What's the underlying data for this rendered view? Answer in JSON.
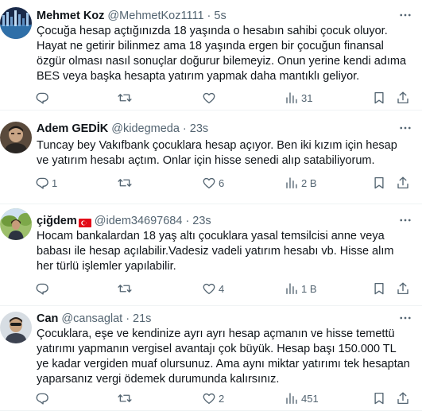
{
  "tweets": [
    {
      "name": "Mehmet Koz",
      "handle": "@MehmetKoz1111",
      "time": "5s",
      "text": "Çocuğa hesap açtığınızda 18 yaşında o hesabın sahibi çocuk oluyor. Hayat ne getirir bilinmez ama 18 yaşında ergen bir çocuğun finansal özgür olması nasıl sonuçlar doğurur bilemeyiz. Onun yerine kendi adıma BES veya başka hesapta yatırım yapmak daha mantıklı geliyor.",
      "replies": "",
      "retweets": "",
      "likes": "",
      "views": "31"
    },
    {
      "name": "Adem GEDİK",
      "handle": "@kidegmeda",
      "time": "23s",
      "text": "Tuncay bey Vakıfbank çocuklara hesap açıyor. Ben iki kızım için hesap ve yatırım hesabı açtım. Onlar için hisse senedi alıp satabiliyorum.",
      "replies": "1",
      "retweets": "",
      "likes": "6",
      "views": "2 B"
    },
    {
      "name": "çiğdem",
      "handle": "@idem34697684",
      "time": "23s",
      "text": "Hocam bankalardan 18 yaş altı çocuklara yasal temsilcisi anne veya babası ile hesap açılabilir.Vadesiz vadeli yatırım hesabı vb. Hisse alım her türlü işlemler yapılabilir.",
      "replies": "",
      "retweets": "",
      "likes": "4",
      "views": "1 B"
    },
    {
      "name": "Can",
      "handle": "@cansaglat",
      "time": "21s",
      "text": "Çocuklara, eşe ve kendinize ayrı ayrı hesap açmanın ve hisse temettü yatırımı yapmanın vergisel avantajı çok büyük. Hesap başı 150.000 TL ye kadar vergiden muaf olursunuz. Ama aynı miktar yatırımı tek hesaptan yaparsanız vergi ödemek durumunda kalırsınız.",
      "replies": "",
      "retweets": "",
      "likes": "2",
      "views": "451"
    }
  ],
  "colors": {
    "text": "#0f1419",
    "secondary": "#536471",
    "border": "#eff3f4",
    "flag_red": "#e30a17"
  },
  "icons": [
    "more-icon",
    "reply-icon",
    "retweet-icon",
    "like-icon",
    "views-icon",
    "bookmark-icon",
    "share-icon",
    "turkish-flag-icon"
  ]
}
